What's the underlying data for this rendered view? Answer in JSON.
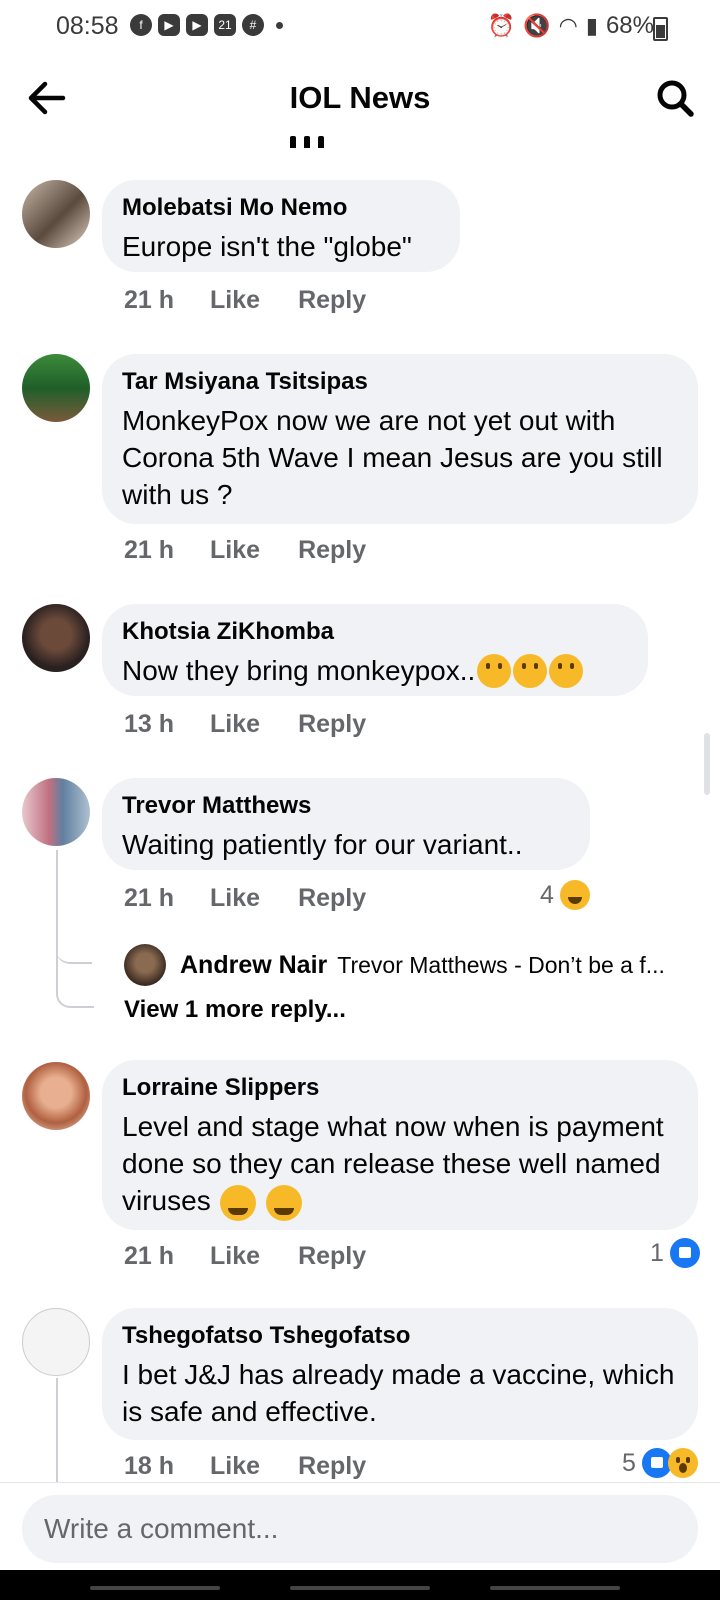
{
  "status_bar": {
    "time": "08:58",
    "date_icon_text": "21",
    "battery": "68%",
    "icons": [
      "facebook-icon",
      "youtube-icon",
      "youtube-icon",
      "calendar-icon",
      "slack-icon",
      "alarm-icon",
      "mute-icon",
      "wifi-icon",
      "signal-icon",
      "battery-icon"
    ]
  },
  "header": {
    "title": "IOL News"
  },
  "comments": [
    {
      "author": "Molebatsi Mo Nemo",
      "text": "Europe isn't the \"globe\"",
      "time": "21 h",
      "like": "Like",
      "reply": "Reply"
    },
    {
      "author": "Tar Msiyana Tsitsipas",
      "text": "MonkeyPox now we are not yet out with Corona 5th Wave I mean Jesus are you still with us ?",
      "time": "21 h",
      "like": "Like",
      "reply": "Reply"
    },
    {
      "author": "Khotsia ZiKhomba",
      "text": "Now they bring monkeypox..",
      "time": "13 h",
      "like": "Like",
      "reply": "Reply"
    },
    {
      "author": "Trevor Matthews",
      "text": "Waiting patiently for our variant..",
      "time": "21 h",
      "like": "Like",
      "reply": "Reply",
      "reactions_count": "4"
    },
    {
      "author": "Lorraine Slippers",
      "text": "Level and stage what now when is payment done so they can release these well named viruses",
      "time": "21 h",
      "like": "Like",
      "reply": "Reply",
      "reactions_count": "1"
    },
    {
      "author": "Tshegofatso Tshegofatso",
      "text": "I bet J&J has already made a vaccine, which is safe and effective.",
      "time": "18 h",
      "like": "Like",
      "reply": "Reply",
      "reactions_count": "5"
    }
  ],
  "reply_preview": {
    "author": "Andrew Nair",
    "text": "Trevor Matthews - Don’t be a f...",
    "more": "View 1 more reply..."
  },
  "composer": {
    "placeholder": "Write a comment..."
  },
  "colors": {
    "bubble": "#f0f2f5",
    "meta": "#65676b",
    "like_blue": "#1877f2",
    "emoji_yellow": "#f7b928"
  }
}
